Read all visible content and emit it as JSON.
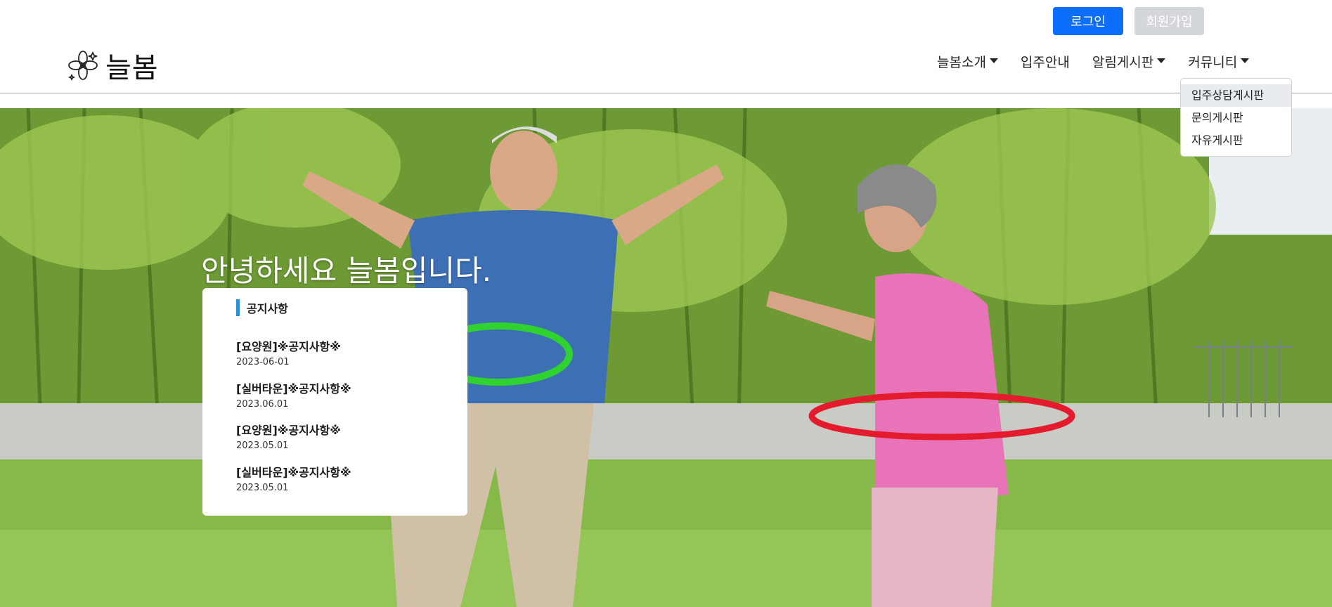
{
  "auth": {
    "login_label": "로그인",
    "signup_label": "회원가입"
  },
  "brand": {
    "name": "늘봄",
    "logo_icon": "flower-icon"
  },
  "nav": {
    "items": [
      {
        "label": "늘봄소개",
        "has_caret": true
      },
      {
        "label": "입주안내",
        "has_caret": false
      },
      {
        "label": "알림게시판",
        "has_caret": true
      },
      {
        "label": "커뮤니티",
        "has_caret": true
      }
    ],
    "dropdown": [
      "입주상담게시판",
      "문의게시판",
      "자유게시판"
    ]
  },
  "hero": {
    "title": "안녕하세요 늘봄입니다."
  },
  "notice_card": {
    "title": "공지사항",
    "items": [
      {
        "title": "[요양원]※공지사항※",
        "date": "2023-06-01"
      },
      {
        "title": "[실버타운]※공지사항※",
        "date": "2023.06.01"
      },
      {
        "title": "[요양원]※공지사항※",
        "date": "2023.05.01"
      },
      {
        "title": "[실버타운]※공지사항※",
        "date": "2023.05.01"
      }
    ]
  },
  "colors": {
    "primary": "#0d6efd",
    "secondary": "#d3d6da",
    "accent_bar": "#2d8fd6"
  }
}
